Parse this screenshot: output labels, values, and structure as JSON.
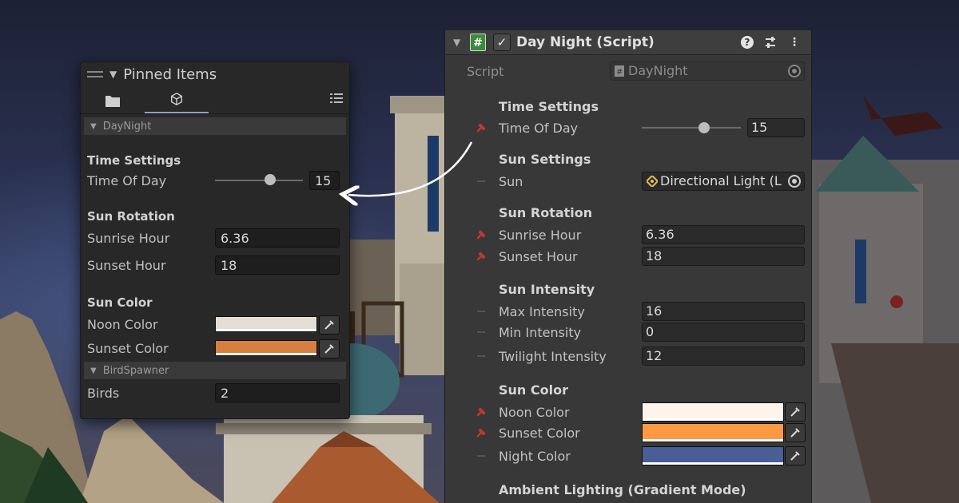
{
  "colors": {
    "noon_small": "#e3ddd6",
    "sunset_small": "#d77f3e",
    "noon": "#fff4ec",
    "sunset": "#fc9a43",
    "night": "#485e95",
    "script_icon": "#3a8b3a"
  },
  "pinned": {
    "title": "Pinned Items",
    "tabs": [
      {
        "icon": "folder-icon"
      },
      {
        "icon": "cube-icon"
      }
    ],
    "sections": {
      "daynight": {
        "label": "DayNight",
        "time_settings": "Time Settings",
        "time_of_day_label": "Time Of Day",
        "time_of_day_value": "15",
        "time_of_day_fraction": 0.625,
        "sun_rotation": "Sun Rotation",
        "sunrise_label": "Sunrise Hour",
        "sunrise_value": "6.36",
        "sunset_label": "Sunset Hour",
        "sunset_value": "18",
        "sun_color": "Sun Color",
        "noon_label": "Noon Color",
        "sunset_color_label": "Sunset Color"
      },
      "birdspawner": {
        "label": "BirdSpawner",
        "birds_label": "Birds",
        "birds_value": "2"
      }
    }
  },
  "inspector": {
    "title": "Day Night (Script)",
    "enabled": true,
    "script_label": "Script",
    "script_value": "DayNight",
    "time_settings": "Time Settings",
    "time_of_day_label": "Time Of Day",
    "time_of_day_value": "15",
    "time_of_day_fraction": 0.625,
    "sun_settings": "Sun Settings",
    "sun_label": "Sun",
    "sun_value": "Directional Light (L",
    "sun_rotation": "Sun Rotation",
    "sunrise_label": "Sunrise Hour",
    "sunrise_value": "6.36",
    "sunset_label": "Sunset Hour",
    "sunset_value": "18",
    "sun_intensity": "Sun Intensity",
    "max_label": "Max Intensity",
    "max_value": "16",
    "min_label": "Min Intensity",
    "min_value": "0",
    "twilight_label": "Twilight Intensity",
    "twilight_value": "12",
    "sun_color": "Sun Color",
    "noon_label": "Noon Color",
    "sunset_color_label": "Sunset Color",
    "night_label": "Night Color",
    "ambient": "Ambient Lighting (Gradient Mode)"
  }
}
